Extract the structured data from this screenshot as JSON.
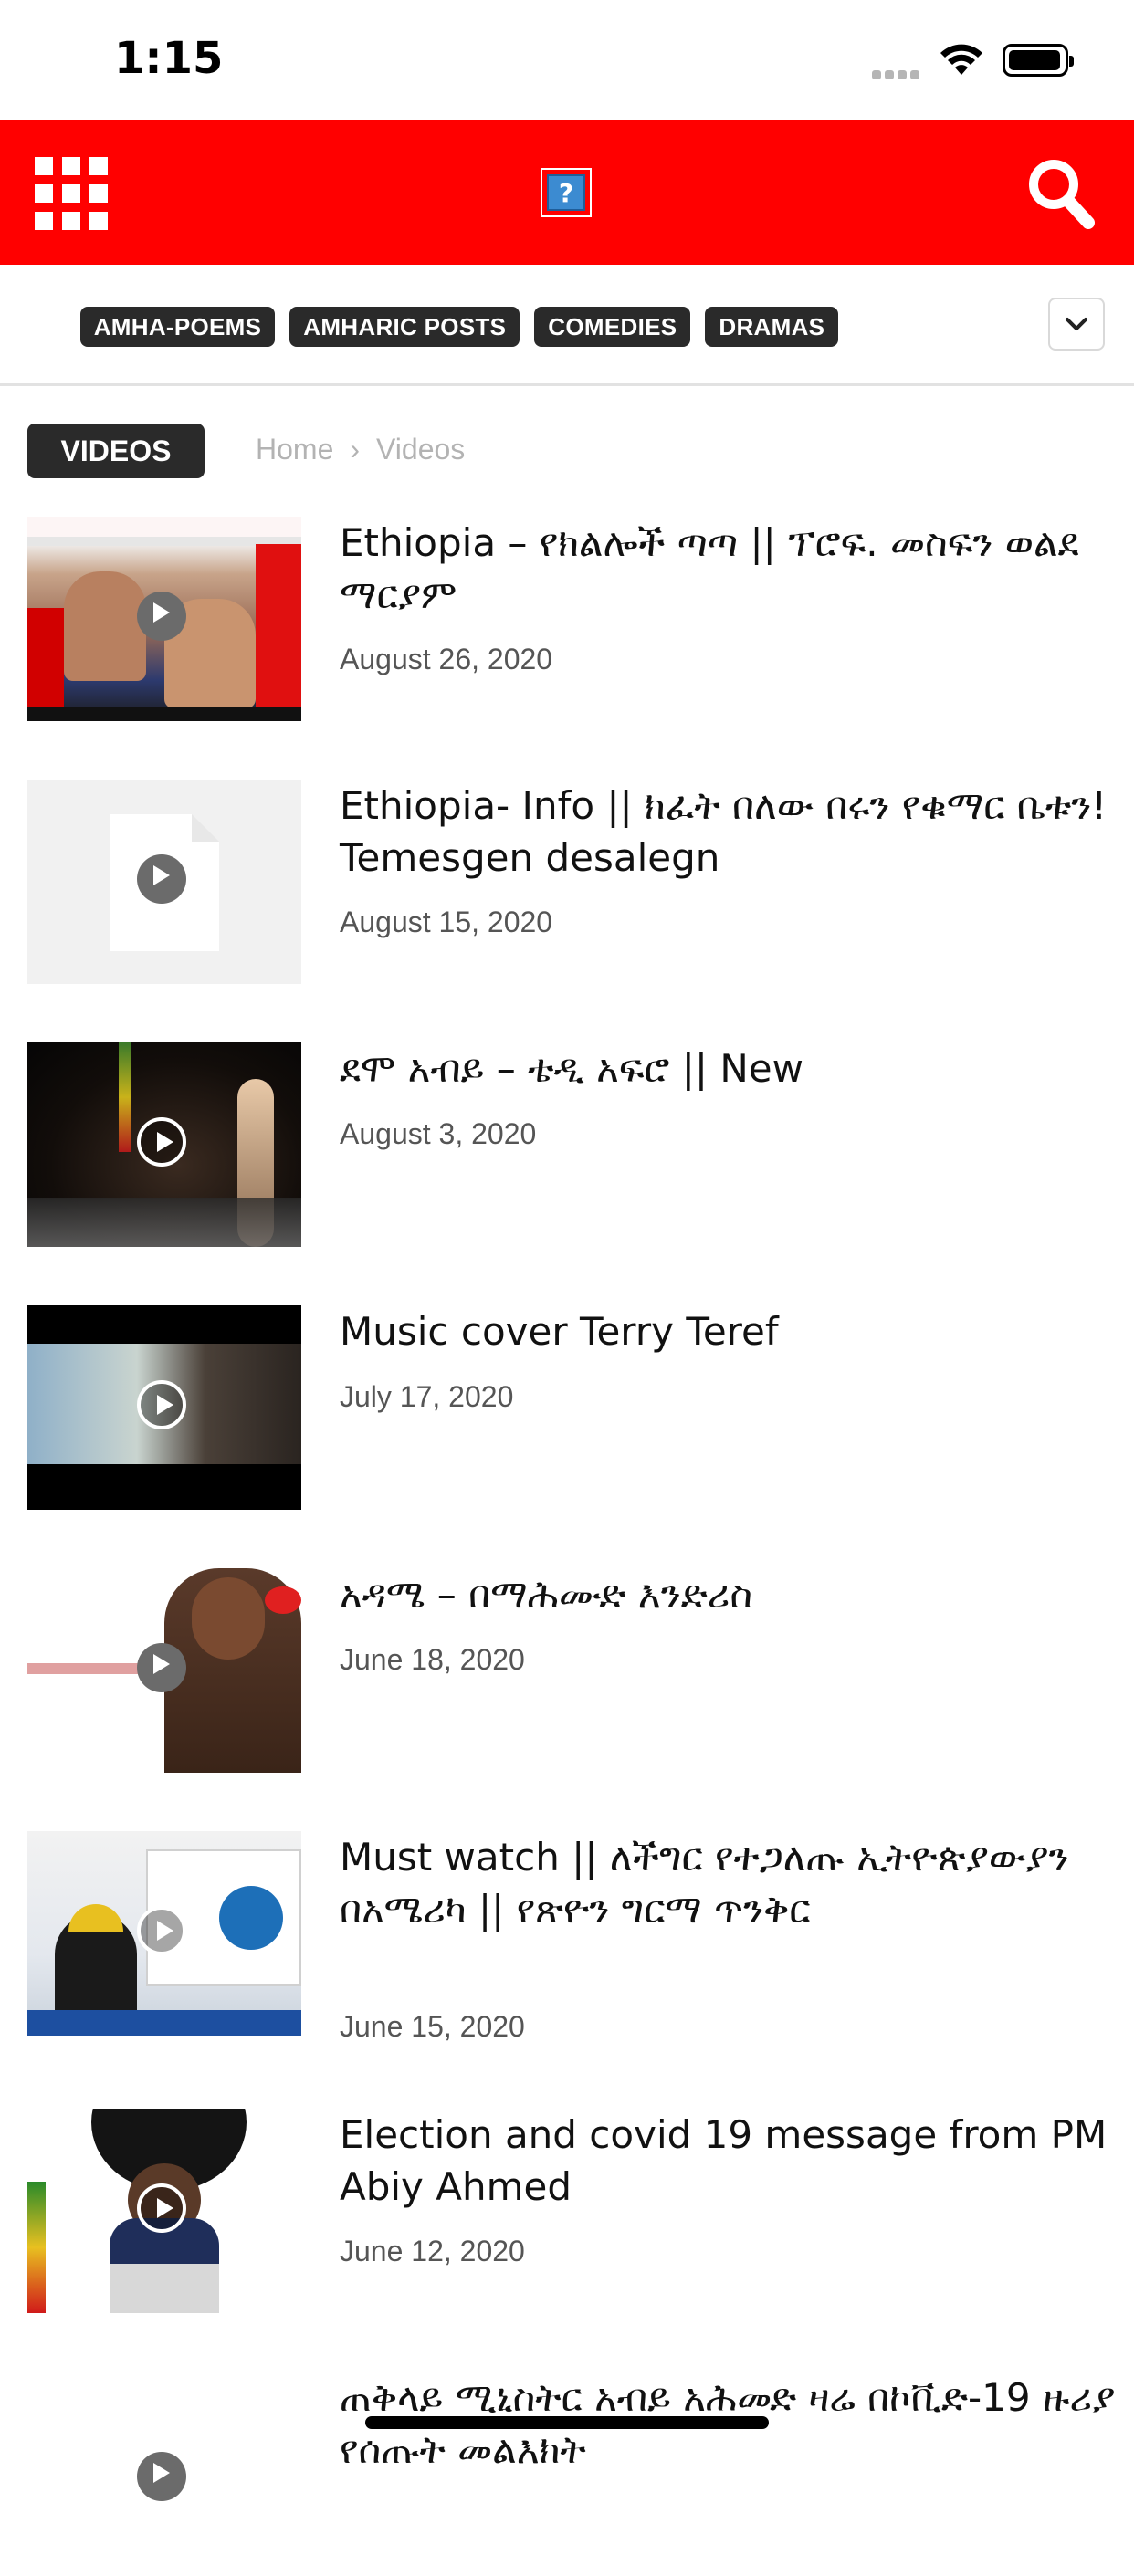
{
  "status_bar": {
    "time": "1:15"
  },
  "header": {
    "logo_placeholder": "?"
  },
  "categories": [
    "AMHA-POEMS",
    "AMHARIC POSTS",
    "COMEDIES",
    "DRAMAS"
  ],
  "section": {
    "badge": "VIDEOS"
  },
  "breadcrumb": {
    "home": "Home",
    "separator": "›",
    "current": "Videos"
  },
  "videos": [
    {
      "title": "Ethiopia – የክልሎች ጣጣ || ፕሮፍ. መስፍን ወልደ ማርያም",
      "date": "August 26, 2020"
    },
    {
      "title": "Ethiopia- Info || ክፈት በለው በሩን የቁማር ቤቱን! Temesgen desalegn",
      "date": "August 15, 2020"
    },
    {
      "title": "ደሞ አብይ – ቴዲ አፍሮ || New",
      "date": "August 3, 2020"
    },
    {
      "title": "Music cover Terry Teref",
      "date": "July 17, 2020"
    },
    {
      "title": "አዳሜ – በማሕሙድ እንድሪስ",
      "date": "June 18, 2020"
    },
    {
      "title": "Must watch || ለችግር የተጋለጡ ኢትዮጵያውያን በአሜሪካ || የጽዮን ግርማ ጥንቅር",
      "date": "June 15, 2020"
    },
    {
      "title": "Election and covid 19 message from PM Abiy Ahmed",
      "date": "June 12, 2020"
    },
    {
      "title": "ጠቅላይ ሚኒስትር አብይ አሕመድ ዛሬ በኮቪድ-19 ዙሪያ የሰጡት መልእክት",
      "date": ""
    }
  ]
}
